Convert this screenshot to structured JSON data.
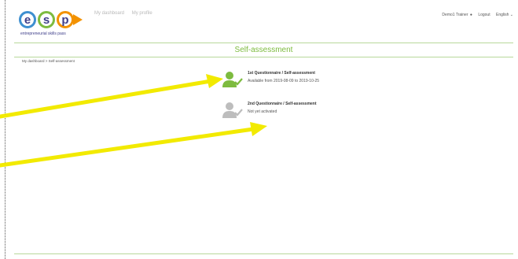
{
  "header": {
    "logo_letters": [
      "e",
      "s",
      "p"
    ],
    "logo_tagline": "entrepreneurial skills pass",
    "nav": [
      "My dashboard",
      "My profile"
    ],
    "user": "Demo1 Trainer",
    "logout": "Logout",
    "language": "English"
  },
  "page": {
    "title": "Self-assessment",
    "breadcrumb": "My dashboard  >  Self-assessment"
  },
  "questionnaires": [
    {
      "title": "1st Questionnaire / Self-assessment",
      "subtitle": "Available from 2019-08-09 to 2019-10-25",
      "status": "active"
    },
    {
      "title": "2nd Questionnaire / Self-assessment",
      "subtitle": "Not yet activated",
      "status": "inactive"
    }
  ],
  "colors": {
    "accent": "#7dbb3f",
    "active_icon": "#7dbb3f",
    "inactive_icon": "#bdbdbd",
    "arrow": "#f2ea00",
    "logo_blue": "#3e3e8a",
    "logo_orange": "#f39200"
  }
}
